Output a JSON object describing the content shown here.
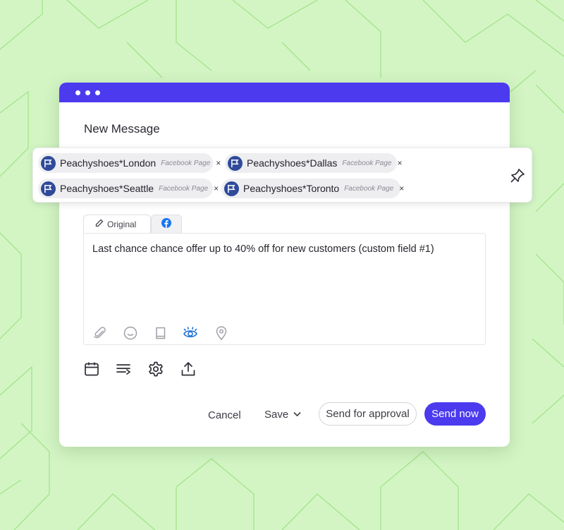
{
  "window": {
    "title": "New Message"
  },
  "recipients": [
    {
      "name": "Peachyshoes*London",
      "type": "Facebook Page",
      "remove": "×"
    },
    {
      "name": "Peachyshoes*Dallas",
      "type": "Facebook Page",
      "remove": "×"
    },
    {
      "name": "Peachyshoes*Seattle",
      "type": "Facebook Page",
      "remove": "×"
    },
    {
      "name": "Peachyshoes*Toronto",
      "type": "Facebook Page",
      "remove": "×"
    }
  ],
  "editor": {
    "tabs": [
      {
        "label": "Original",
        "icon": "pencil-icon"
      },
      {
        "label": "",
        "icon": "facebook-icon"
      }
    ],
    "message": "Last chance chance offer up to 40% off for new customers (custom field #1)",
    "tools": [
      "paperclip-icon",
      "smiley-icon",
      "book-icon",
      "eye-icon",
      "location-pin-icon"
    ]
  },
  "bottom_tools": [
    "calendar-icon",
    "text-lines-icon",
    "gear-icon",
    "upload-icon"
  ],
  "actions": {
    "cancel": "Cancel",
    "save": "Save",
    "send_for_approval": "Send for approval",
    "send_now": "Send now"
  },
  "colors": {
    "brand": "#4b3aee",
    "background": "#d3f5c4",
    "pattern_line": "#9ee07f",
    "avatar": "#2f4a9a",
    "facebook": "#1877f2",
    "active_tool": "#1e6fd9"
  }
}
